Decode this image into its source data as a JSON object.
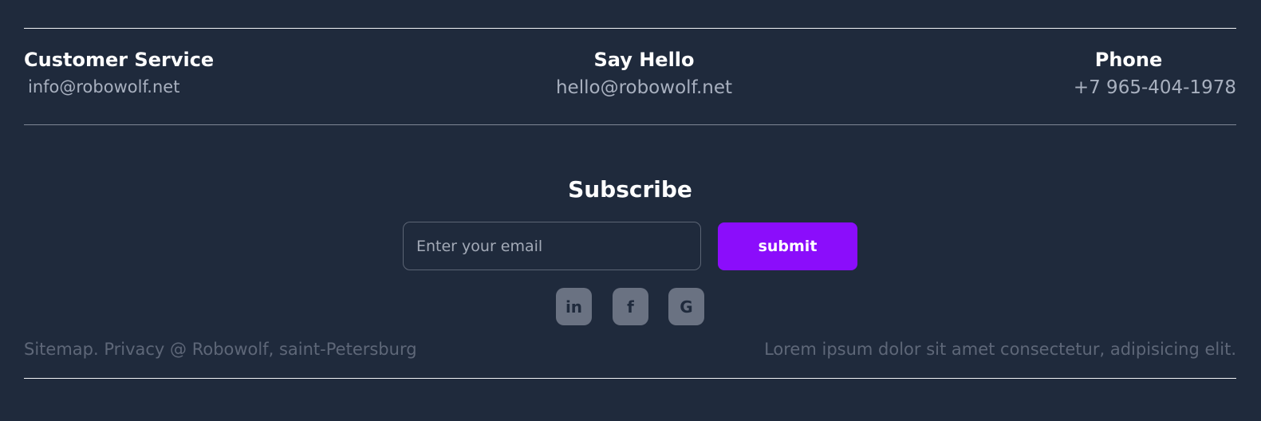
{
  "contacts": {
    "customer_service": {
      "title": "Customer Service",
      "value": "info@robowolf.net"
    },
    "say_hello": {
      "title": "Say Hello",
      "value": "hello@robowolf.net"
    },
    "phone": {
      "title": "Phone",
      "value": "+7 965-404-1978"
    }
  },
  "subscribe": {
    "title": "Subscribe",
    "email_placeholder": "Enter your email",
    "email_value": "",
    "submit_label": "submit"
  },
  "social": {
    "linkedin": {
      "icon": "linkedin-icon",
      "glyph": "in"
    },
    "facebook": {
      "icon": "facebook-icon",
      "glyph": "f"
    },
    "google": {
      "icon": "google-icon",
      "glyph": "G"
    }
  },
  "footer": {
    "left_text": "Sitemap. Privacy @ Robowolf, saint-Petersburg",
    "right_text": "Lorem ipsum dolor sit amet consectetur, adipisicing elit."
  },
  "colors": {
    "background": "#1f2a3c",
    "accent": "#8b0dfb",
    "social_bg": "#6a7282",
    "muted_text": "#5e6778"
  }
}
